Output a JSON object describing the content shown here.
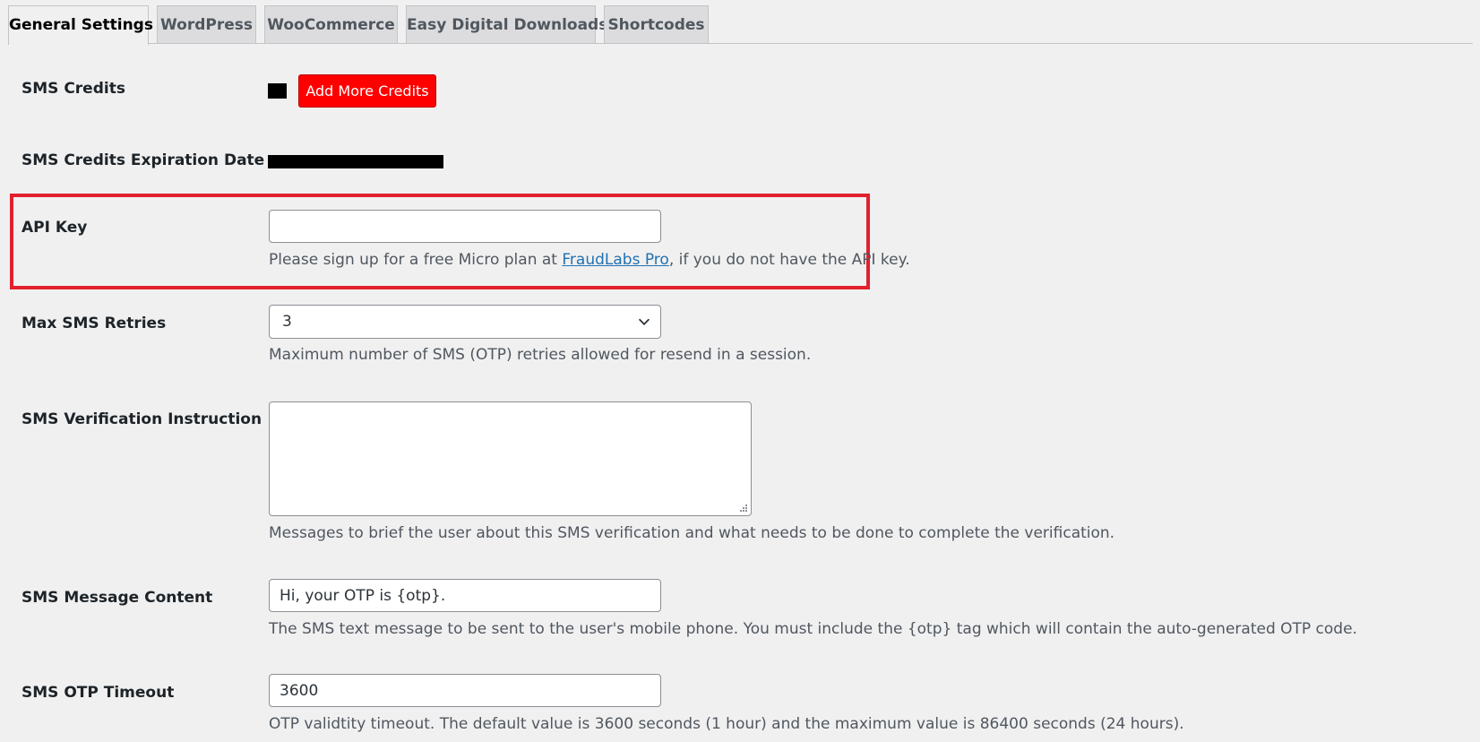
{
  "tabs": [
    {
      "label": "General Settings",
      "active": true
    },
    {
      "label": "WordPress",
      "active": false
    },
    {
      "label": "WooCommerce",
      "active": false
    },
    {
      "label": "Easy Digital Downloads",
      "active": false
    },
    {
      "label": "Shortcodes",
      "active": false
    }
  ],
  "sms_credits": {
    "label": "SMS Credits",
    "button_label": "Add More Credits",
    "button_color": "#ff0000"
  },
  "sms_credits_expiration": {
    "label": "SMS Credits Expiration Date"
  },
  "api_key": {
    "label": "API Key",
    "value": "",
    "desc_before": "Please sign up for a free Micro plan at ",
    "link_text": "FraudLabs Pro",
    "desc_after": ", if you do not have the API key.",
    "highlight_color": "#e2202e"
  },
  "max_sms_retries": {
    "label": "Max SMS Retries",
    "selected": "3",
    "desc": "Maximum number of SMS (OTP) retries allowed for resend in a session."
  },
  "sms_verification_instruction": {
    "label": "SMS Verification Instruction",
    "value": "",
    "desc": "Messages to brief the user about this SMS verification and what needs to be done to complete the verification."
  },
  "sms_message_content": {
    "label": "SMS Message Content",
    "value": "Hi, your OTP is {otp}.",
    "desc": "The SMS text message to be sent to the user's mobile phone. You must include the {otp} tag which will contain the auto-generated OTP code."
  },
  "sms_otp_timeout": {
    "label": "SMS OTP Timeout",
    "value": "3600",
    "desc": "OTP validtity timeout. The default value is 3600 seconds (1 hour) and the maximum value is 86400 seconds (24 hours)."
  },
  "icons": {
    "select_arrow": "chevron-down-icon",
    "textarea_resize": "resize-grip-icon"
  }
}
